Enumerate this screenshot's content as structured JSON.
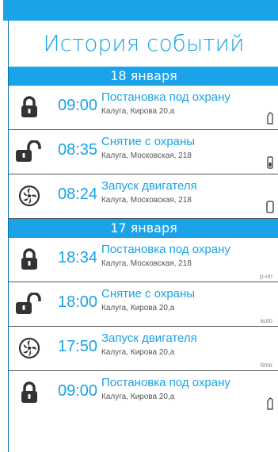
{
  "header": {
    "title": "История событий"
  },
  "groups": [
    {
      "date": "18 января",
      "events": [
        {
          "icon": "lock-closed-icon",
          "time": "09:00",
          "name": "Постановка под охрану",
          "address": "Калуга, Кирова 20,а",
          "source_icon": "key-fob-icon"
        },
        {
          "icon": "lock-open-icon",
          "time": "08:35",
          "name": "Снятие с охраны",
          "address": "Калуга, Московская, 218",
          "source_icon": "remote-control-icon"
        },
        {
          "icon": "engine-start-icon",
          "time": "08:24",
          "name": "Запуск двигателя",
          "address": "Калуга, Московская, 218",
          "source_icon": "smartphone-icon"
        }
      ]
    },
    {
      "date": "17 января",
      "events": [
        {
          "icon": "lock-closed-icon",
          "time": "18:34",
          "name": "Постановка под охрану",
          "address": "Калуга, Московская, 218",
          "source_text": "p-on"
        },
        {
          "icon": "lock-open-icon",
          "time": "18:00",
          "name": "Снятие с охраны",
          "address": "Калуга, Кирова 20,а",
          "source_text": "auto"
        },
        {
          "icon": "engine-start-icon",
          "time": "17:50",
          "name": "Запуск двигателя",
          "address": "Калуга, Кирова 20,а",
          "source_text": "time"
        },
        {
          "icon": "lock-closed-icon",
          "time": "09:00",
          "name": "Постановка под охрану",
          "address": "Калуга, Кирова 20,а",
          "source_icon": "key-fob-icon"
        }
      ]
    }
  ],
  "colors": {
    "accent": "#1aa3e8",
    "icon": "#333333"
  }
}
